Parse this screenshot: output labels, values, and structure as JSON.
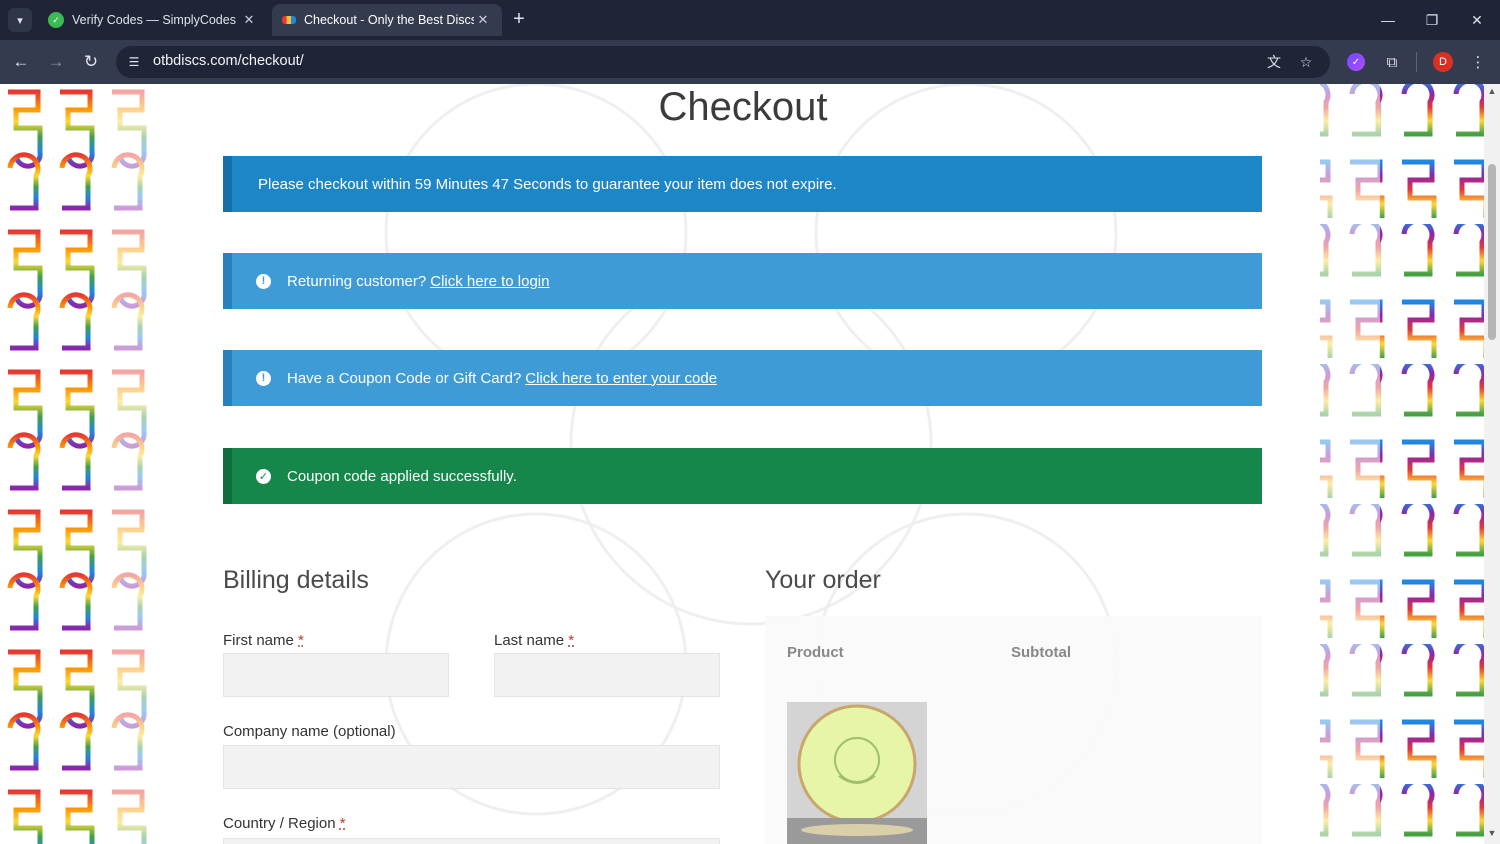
{
  "browser": {
    "tabs": [
      {
        "title": "Verify Codes — SimplyCodes",
        "active": false
      },
      {
        "title": "Checkout - Only the Best Discs",
        "active": true
      }
    ],
    "url": "otbdiscs.com/checkout/",
    "profile_initial": "D",
    "icons": {
      "tab_menu": "chevron-down-icon",
      "close": "close-icon",
      "new_tab": "plus-icon",
      "back": "arrow-left-icon",
      "forward": "arrow-right-icon",
      "reload": "reload-icon",
      "site_info": "tune-icon",
      "translate": "translate-icon",
      "bookmark": "star-icon",
      "extension": "extension-icon",
      "extensions_menu": "puzzle-icon",
      "menu": "kebab-menu-icon"
    },
    "colors": {
      "chrome_dark": "#1f2537",
      "chrome_toolbar": "#343b4f",
      "profile": "#d93025"
    }
  },
  "page": {
    "title": "Checkout",
    "notices": {
      "timer": "Please checkout within 59 Minutes 47 Seconds to guarantee your item does not expire.",
      "login_text": "Returning customer?",
      "login_link": "Click here to login",
      "coupon_text": "Have a Coupon Code or Gift Card?",
      "coupon_link": "Click here to enter your code",
      "success": "Coupon code applied successfully."
    },
    "colors": {
      "timer": "#1d86c6",
      "info": "#3f9bd6",
      "success": "#15874a"
    },
    "billing": {
      "title": "Billing details",
      "first_name_label": "First name",
      "last_name_label": "Last name",
      "company_label": "Company name (optional)",
      "country_label": "Country / Region",
      "required_mark": "*"
    },
    "order": {
      "title": "Your order",
      "col_product": "Product",
      "col_subtotal": "Subtotal"
    }
  }
}
